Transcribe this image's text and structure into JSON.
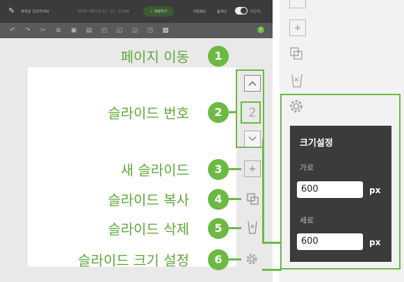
{
  "header": {
    "doc_title": "제목을 입력하세요",
    "autosave_text": "마지막 저장시간 11 : 11 : 13 AM",
    "save_label": "저장하기",
    "menu_a": "다운로드",
    "menu_b": "옵셔너",
    "toggle_label": "비공개"
  },
  "callouts": [
    {
      "number": "1",
      "label": "페이지 이동"
    },
    {
      "number": "2",
      "label": "슬라이드 번호"
    },
    {
      "number": "3",
      "label": "새 슬라이드"
    },
    {
      "number": "4",
      "label": "슬라이드 복사"
    },
    {
      "number": "5",
      "label": "슬라이드 삭제"
    },
    {
      "number": "6",
      "label": "슬라이드 크기 설정"
    }
  ],
  "slide_number": "2",
  "popup": {
    "title": "크기설정",
    "width_label": "가로",
    "width_value": "600",
    "width_unit": "px",
    "height_label": "세로",
    "height_value": "600",
    "height_unit": "px"
  },
  "colors": {
    "accent": "#6cb944",
    "topbar": "#3b3b3b",
    "toolbar": "#5a5a5a",
    "popup_bg": "#3b3b3b"
  }
}
